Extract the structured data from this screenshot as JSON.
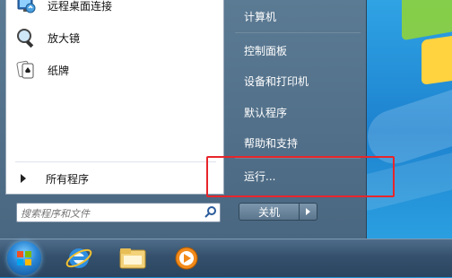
{
  "left_pane": {
    "programs": [
      {
        "label": "远程桌面连接",
        "icon": "remote-desktop-icon"
      },
      {
        "label": "放大镜",
        "icon": "magnifier-icon"
      },
      {
        "label": "纸牌",
        "icon": "solitaire-icon"
      }
    ],
    "all_programs": "所有程序",
    "search": {
      "placeholder": "搜索程序和文件",
      "icon": "search-icon"
    }
  },
  "right_pane": {
    "items": [
      {
        "label": "计算机"
      },
      {
        "label": "控制面板"
      },
      {
        "label": "设备和打印机"
      },
      {
        "label": "默认程序"
      },
      {
        "label": "帮助和支持"
      },
      {
        "label": "运行..."
      }
    ],
    "shutdown": "关机"
  },
  "taskbar": {
    "items": [
      "start-orb-icon",
      "internet-explorer-icon",
      "file-explorer-icon",
      "media-player-icon"
    ]
  },
  "colors": {
    "highlight": "#e8252b",
    "menu_bg": "#4a6781"
  }
}
